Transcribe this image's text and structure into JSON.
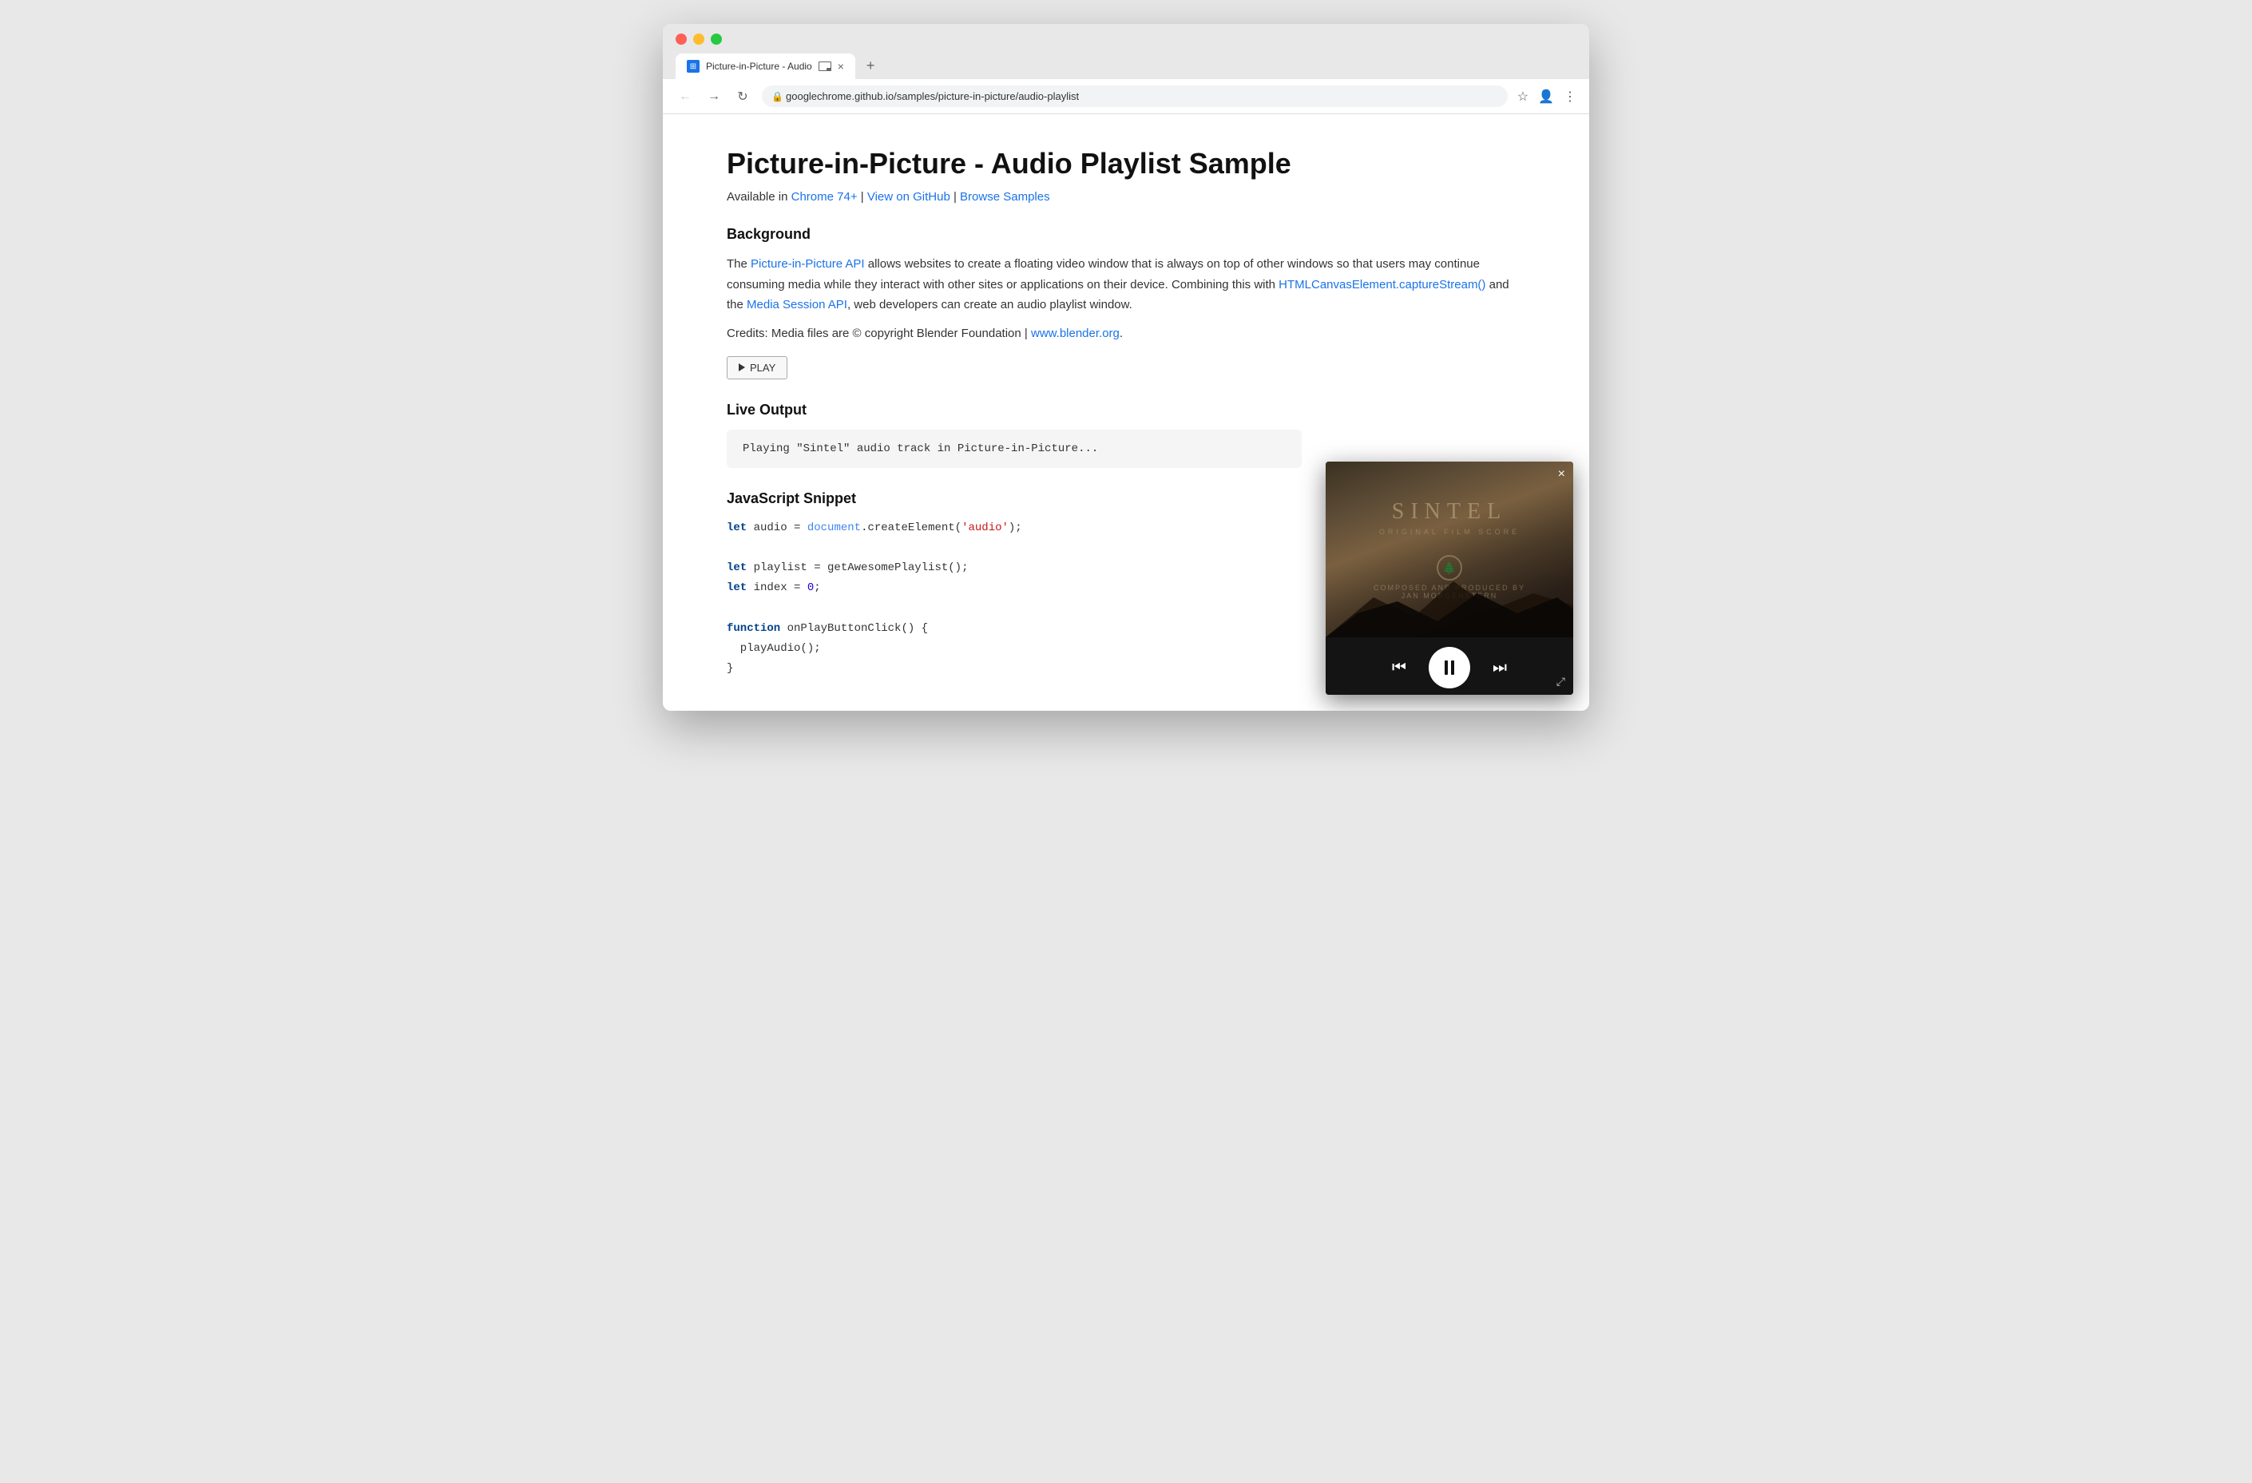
{
  "browser": {
    "tab_title": "Picture-in-Picture - Audio",
    "tab_favicon": "☰",
    "new_tab_label": "+",
    "address": "googlechrome.github.io/samples/picture-in-picture/audio-playlist",
    "nav": {
      "back": "←",
      "forward": "→",
      "reload": "↻"
    }
  },
  "page": {
    "title": "Picture-in-Picture - Audio Playlist Sample",
    "availability": {
      "prefix": "Available in",
      "chrome_link": "Chrome 74+",
      "github_link": "View on GitHub",
      "samples_link": "Browse Samples"
    },
    "background": {
      "heading": "Background",
      "paragraph1_prefix": "The ",
      "paragraph1_link": "Picture-in-Picture API",
      "paragraph1_suffix": " allows websites to create a floating video window that is always on top of other windows so that users may continue consuming media while they interact with other sites or applications on their device. Combining this with ",
      "paragraph1_link2": "HTMLCanvasElement.captureStream()",
      "paragraph1_middle": " and the ",
      "paragraph1_link3": "Media Session API",
      "paragraph1_end": ", web developers can create an audio playlist window.",
      "credits": "Credits: Media files are © copyright Blender Foundation | ",
      "credits_link": "www.blender.org",
      "credits_end": "."
    },
    "play_button": "PLAY",
    "live_output": {
      "heading": "Live Output",
      "text": "Playing \"Sintel\" audio track in Picture-in-Picture..."
    },
    "js_snippet": {
      "heading": "JavaScript Snippet",
      "lines": [
        {
          "type": "code",
          "content": "let audio = document.createElement('audio');"
        },
        {
          "type": "blank"
        },
        {
          "type": "code",
          "content": "let playlist = getAwesomePlaylist();"
        },
        {
          "type": "code",
          "content": "let index = 0;"
        },
        {
          "type": "blank"
        },
        {
          "type": "code",
          "content": "function onPlayButtonClick() {"
        },
        {
          "type": "code",
          "content": "  playAudio();"
        },
        {
          "type": "code",
          "content": "}"
        }
      ]
    }
  },
  "pip": {
    "title": "SINTEL",
    "subtitle": "ORIGINAL FILM SCORE",
    "composer_label": "Composed and Produced by",
    "composer_name": "JAN MORGENSTERN",
    "close_label": "×",
    "expand_label": "⤢"
  }
}
